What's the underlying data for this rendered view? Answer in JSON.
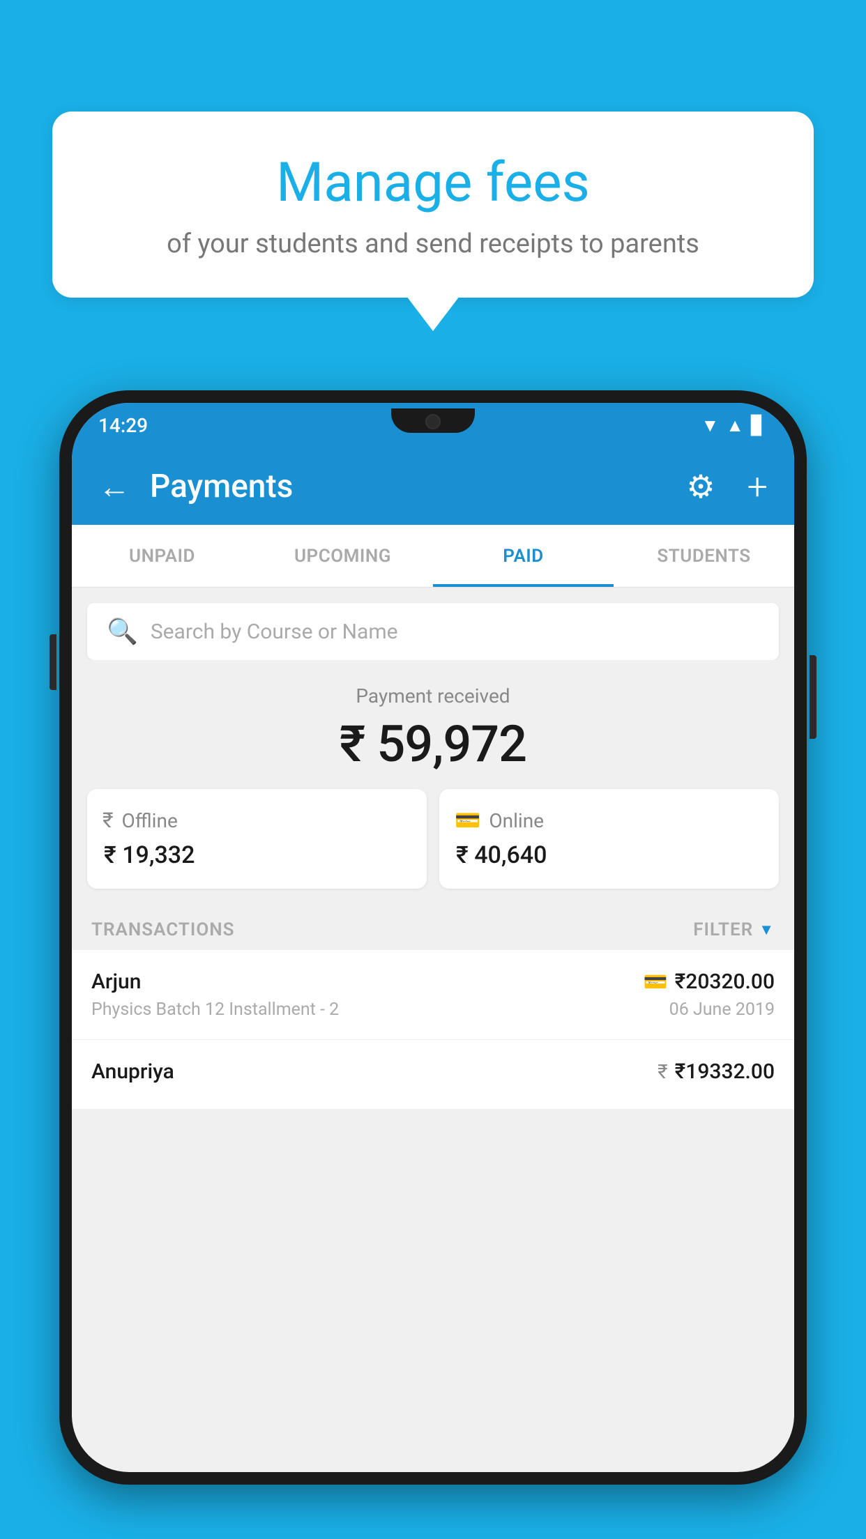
{
  "background_color": "#1AAFE6",
  "speech_bubble": {
    "title": "Manage fees",
    "subtitle": "of your students and send receipts to parents"
  },
  "status_bar": {
    "time": "14:29",
    "wifi": "▲",
    "signal": "▲",
    "battery": "▊"
  },
  "app_bar": {
    "title": "Payments",
    "back_icon": "←",
    "gear_icon": "⚙",
    "plus_icon": "+"
  },
  "tabs": [
    {
      "label": "UNPAID",
      "active": false
    },
    {
      "label": "UPCOMING",
      "active": false
    },
    {
      "label": "PAID",
      "active": true
    },
    {
      "label": "STUDENTS",
      "active": false
    }
  ],
  "search": {
    "placeholder": "Search by Course or Name"
  },
  "payment_summary": {
    "label": "Payment received",
    "amount": "₹ 59,972"
  },
  "payment_cards": [
    {
      "type": "Offline",
      "amount": "₹ 19,332",
      "icon": "₹"
    },
    {
      "type": "Online",
      "amount": "₹ 40,640",
      "icon": "▭"
    }
  ],
  "transactions_section": {
    "label": "TRANSACTIONS",
    "filter_label": "FILTER"
  },
  "transactions": [
    {
      "name": "Arjun",
      "detail": "Physics Batch 12 Installment - 2",
      "amount": "₹20320.00",
      "date": "06 June 2019",
      "payment_type": "online"
    },
    {
      "name": "Anupriya",
      "detail": "",
      "amount": "₹19332.00",
      "date": "",
      "payment_type": "offline"
    }
  ]
}
